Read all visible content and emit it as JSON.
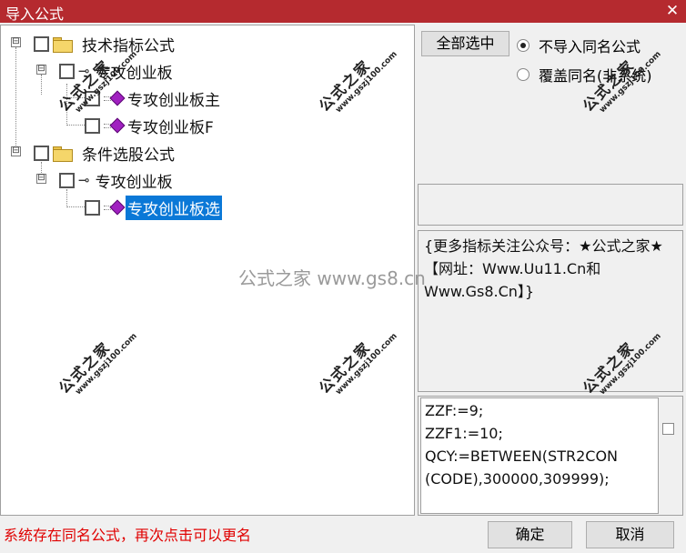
{
  "window": {
    "title": "导入公式",
    "close_glyph": "✕"
  },
  "tree": {
    "root1": {
      "label": "技术指标公式",
      "children": [
        {
          "label": "专攻创业板",
          "children": [
            {
              "label": "专攻创业板主"
            },
            {
              "label": "专攻创业板F"
            }
          ]
        }
      ]
    },
    "root2": {
      "label": "条件选股公式",
      "children": [
        {
          "label": "专攻创业板",
          "children": [
            {
              "label": "专攻创业板选",
              "selected": true
            }
          ]
        }
      ]
    }
  },
  "buttons": {
    "select_all": "全部选中",
    "ok": "确定",
    "cancel": "取消"
  },
  "options": {
    "no_import": {
      "label": "不导入同名公式",
      "checked": true
    },
    "overwrite": {
      "label": "覆盖同名(非系统)",
      "checked": false
    }
  },
  "description": "{更多指标关注公众号：★公式之家★【网址：Www.Uu11.Cn和Www.Gs8.Cn】}",
  "code_lines": [
    "ZZF:=9;",
    "ZZF1:=10;",
    "QCY:=BETWEEN(STR2CON",
    "(CODE),300000,309999);"
  ],
  "status_text": "系统存在同名公式，再次点击可以更名",
  "watermark": {
    "big": "公式之家",
    "small": "www.gszj100.com",
    "center": "公式之家 www.gs8.cn"
  },
  "icons": {
    "expander": "⊟",
    "key": "⊸"
  },
  "colors": {
    "titlebar": "#b52a2f",
    "selection": "#0a78d7",
    "status": "#e00000"
  }
}
